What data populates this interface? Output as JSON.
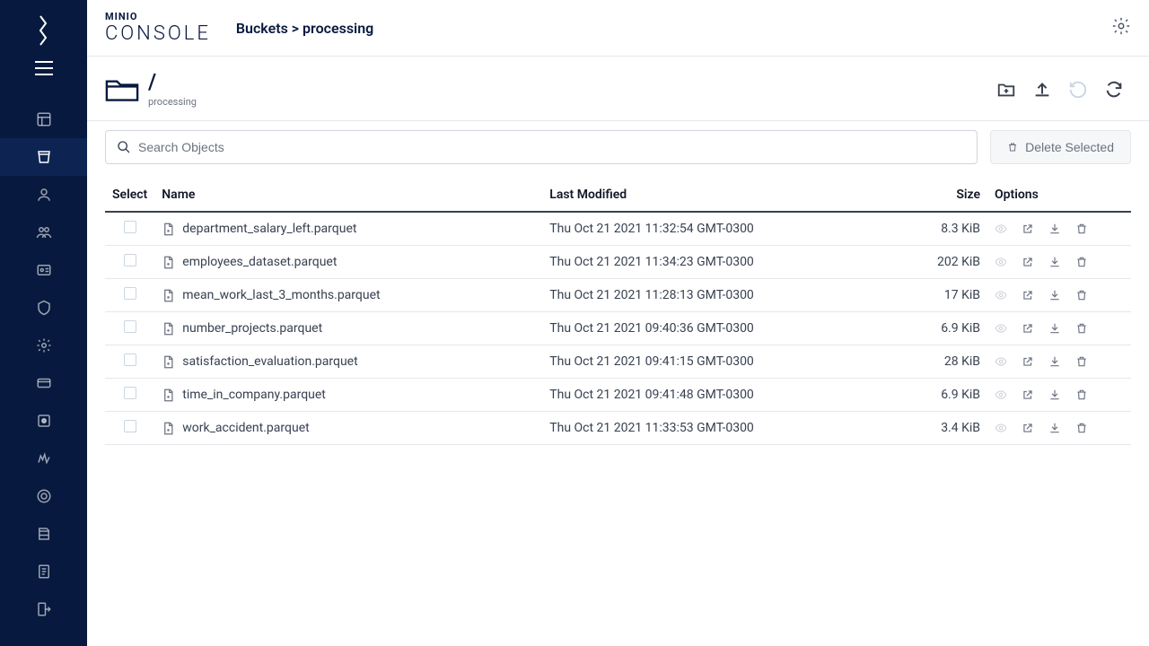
{
  "brand": {
    "line1": "MINIO",
    "line2": "CONSOLE"
  },
  "breadcrumb": "Buckets > processing",
  "path": {
    "current": "/",
    "bucket": "processing"
  },
  "search": {
    "placeholder": "Search Objects"
  },
  "delete_button": "Delete Selected",
  "columns": {
    "select": "Select",
    "name": "Name",
    "modified": "Last Modified",
    "size": "Size",
    "options": "Options"
  },
  "files": [
    {
      "name": "department_salary_left.parquet",
      "modified": "Thu Oct 21 2021 11:32:54 GMT-0300",
      "size": "8.3 KiB"
    },
    {
      "name": "employees_dataset.parquet",
      "modified": "Thu Oct 21 2021 11:34:23 GMT-0300",
      "size": "202 KiB"
    },
    {
      "name": "mean_work_last_3_months.parquet",
      "modified": "Thu Oct 21 2021 11:28:13 GMT-0300",
      "size": "17 KiB"
    },
    {
      "name": "number_projects.parquet",
      "modified": "Thu Oct 21 2021 09:40:36 GMT-0300",
      "size": "6.9 KiB"
    },
    {
      "name": "satisfaction_evaluation.parquet",
      "modified": "Thu Oct 21 2021 09:41:15 GMT-0300",
      "size": "28 KiB"
    },
    {
      "name": "time_in_company.parquet",
      "modified": "Thu Oct 21 2021 09:41:48 GMT-0300",
      "size": "6.9 KiB"
    },
    {
      "name": "work_accident.parquet",
      "modified": "Thu Oct 21 2021 11:33:53 GMT-0300",
      "size": "3.4 KiB"
    }
  ]
}
